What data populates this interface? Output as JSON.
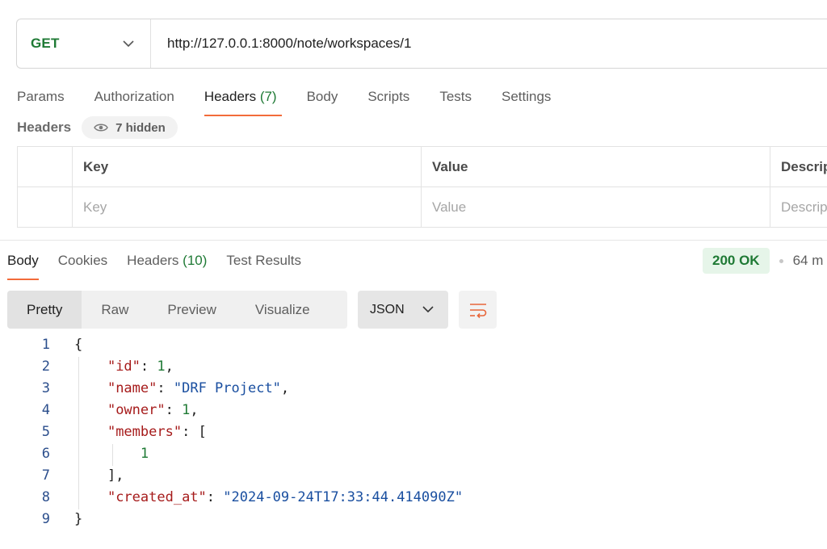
{
  "request": {
    "method": "GET",
    "url": "http://127.0.0.1:8000/note/workspaces/1"
  },
  "request_tabs": [
    {
      "label": "Params"
    },
    {
      "label": "Authorization"
    },
    {
      "label": "Headers",
      "count": "(7)"
    },
    {
      "label": "Body"
    },
    {
      "label": "Scripts"
    },
    {
      "label": "Tests"
    },
    {
      "label": "Settings"
    }
  ],
  "headers_section": {
    "title": "Headers",
    "hidden_label": "7 hidden"
  },
  "headers_table": {
    "columns": [
      "Key",
      "Value",
      "Descrip"
    ],
    "placeholders": [
      "Key",
      "Value",
      "Descrip"
    ]
  },
  "response_tabs": [
    {
      "label": "Body"
    },
    {
      "label": "Cookies"
    },
    {
      "label": "Headers",
      "count": "(10)"
    },
    {
      "label": "Test Results"
    }
  ],
  "status": {
    "code": "200 OK",
    "time": "64 m"
  },
  "view_modes": [
    "Pretty",
    "Raw",
    "Preview",
    "Visualize"
  ],
  "format": "JSON",
  "code_lines": [
    {
      "n": "1",
      "parts": [
        {
          "t": "{",
          "c": ""
        }
      ]
    },
    {
      "n": "2",
      "parts": [
        {
          "t": "    ",
          "c": ""
        },
        {
          "t": "\"id\"",
          "c": "key"
        },
        {
          "t": ": ",
          "c": ""
        },
        {
          "t": "1",
          "c": "num"
        },
        {
          "t": ",",
          "c": ""
        }
      ]
    },
    {
      "n": "3",
      "parts": [
        {
          "t": "    ",
          "c": ""
        },
        {
          "t": "\"name\"",
          "c": "key"
        },
        {
          "t": ": ",
          "c": ""
        },
        {
          "t": "\"DRF Project\"",
          "c": "str"
        },
        {
          "t": ",",
          "c": ""
        }
      ]
    },
    {
      "n": "4",
      "parts": [
        {
          "t": "    ",
          "c": ""
        },
        {
          "t": "\"owner\"",
          "c": "key"
        },
        {
          "t": ": ",
          "c": ""
        },
        {
          "t": "1",
          "c": "num"
        },
        {
          "t": ",",
          "c": ""
        }
      ]
    },
    {
      "n": "5",
      "parts": [
        {
          "t": "    ",
          "c": ""
        },
        {
          "t": "\"members\"",
          "c": "key"
        },
        {
          "t": ": [",
          "c": ""
        }
      ]
    },
    {
      "n": "6",
      "parts": [
        {
          "t": "        ",
          "c": ""
        },
        {
          "t": "1",
          "c": "num"
        }
      ]
    },
    {
      "n": "7",
      "parts": [
        {
          "t": "    ],",
          "c": ""
        }
      ]
    },
    {
      "n": "8",
      "parts": [
        {
          "t": "    ",
          "c": ""
        },
        {
          "t": "\"created_at\"",
          "c": "key"
        },
        {
          "t": ": ",
          "c": ""
        },
        {
          "t": "\"2024-09-24T17:33:44.414090Z\"",
          "c": "str"
        }
      ]
    },
    {
      "n": "9",
      "parts": [
        {
          "t": "}",
          "c": ""
        }
      ]
    }
  ],
  "colors": {
    "accent": "#f26b3a",
    "success": "#1f7a35",
    "json_key": "#a61b1b",
    "json_string": "#1a4fa0"
  },
  "icons": {
    "method_dropdown": "chevron-down-icon",
    "hidden_headers": "eye-icon",
    "format_dropdown": "chevron-down-icon",
    "wrap": "wrap-lines-icon"
  }
}
